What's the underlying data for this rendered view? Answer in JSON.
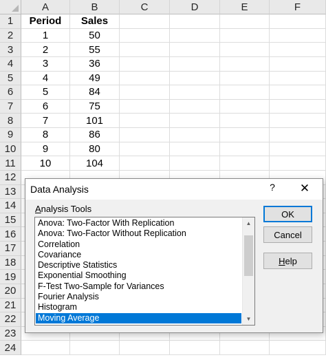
{
  "sheet": {
    "columns": [
      "A",
      "B",
      "C",
      "D",
      "E",
      "F"
    ],
    "rows": [
      "1",
      "2",
      "3",
      "4",
      "5",
      "6",
      "7",
      "8",
      "9",
      "10",
      "11",
      "12",
      "13",
      "14",
      "15",
      "16",
      "17",
      "18",
      "19",
      "20",
      "21",
      "22",
      "23",
      "24"
    ],
    "header": [
      "Period",
      "Sales"
    ],
    "data": [
      [
        "1",
        "50"
      ],
      [
        "2",
        "55"
      ],
      [
        "3",
        "36"
      ],
      [
        "4",
        "49"
      ],
      [
        "5",
        "84"
      ],
      [
        "6",
        "75"
      ],
      [
        "7",
        "101"
      ],
      [
        "8",
        "86"
      ],
      [
        "9",
        "80"
      ],
      [
        "10",
        "104"
      ]
    ]
  },
  "dialog": {
    "title": "Data Analysis",
    "help_glyph": "?",
    "close_glyph": "✕",
    "tools_label_accel": "A",
    "tools_label_rest": "nalysis Tools",
    "tools": [
      "Anova: Two-Factor With Replication",
      "Anova: Two-Factor Without Replication",
      "Correlation",
      "Covariance",
      "Descriptive Statistics",
      "Exponential Smoothing",
      "F-Test Two-Sample for Variances",
      "Fourier Analysis",
      "Histogram",
      "Moving Average"
    ],
    "selected_tool": "Moving Average",
    "ok_label": "OK",
    "cancel_label": "Cancel",
    "help_accel": "H",
    "help_rest": "elp",
    "accent_color": "#0078d7"
  }
}
